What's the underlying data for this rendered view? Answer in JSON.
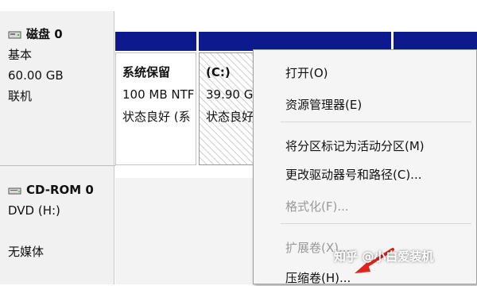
{
  "disk0": {
    "title": "磁盘 0",
    "type": "基本",
    "size": "60.00 GB",
    "status": "联机"
  },
  "cdrom0": {
    "title": "CD-ROM 0",
    "drive": "DVD (H:)",
    "media": "无媒体"
  },
  "partitions": [
    {
      "name": "系统保留",
      "size": "100 MB NTF",
      "status": "状态良好 (系"
    },
    {
      "name": "(C:)",
      "size": "39.90 GE",
      "status": "状态良好"
    }
  ],
  "context_menu": {
    "items": [
      {
        "label": "打开(O)",
        "enabled": true
      },
      {
        "label": "资源管理器(E)",
        "enabled": true
      },
      {
        "label": "将分区标记为活动分区(M)",
        "enabled": true
      },
      {
        "label": "更改驱动器号和路径(C)...",
        "enabled": true
      },
      {
        "label": "格式化(F)...",
        "enabled": false
      },
      {
        "label": "扩展卷(X)...",
        "enabled": false
      },
      {
        "label": "压缩卷(H)...",
        "enabled": true
      }
    ]
  },
  "watermark": "知乎 @小白爱装机",
  "colors": {
    "partition_bar": "#0d1a8e",
    "arrow": "#e0241b"
  }
}
